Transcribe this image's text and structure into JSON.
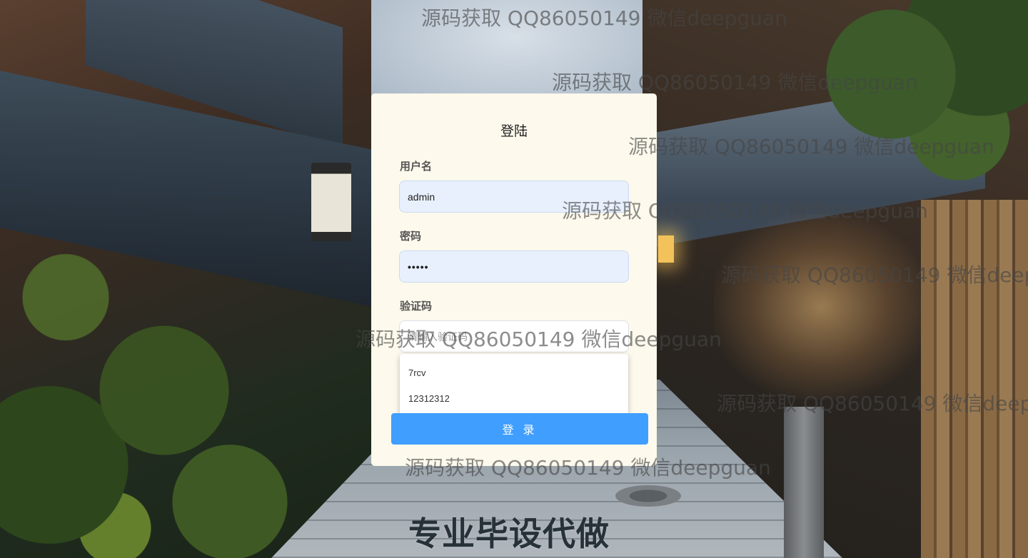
{
  "login": {
    "title": "登陆",
    "username_label": "用户名",
    "username_value": "admin",
    "password_label": "密码",
    "password_value": "•••••",
    "captcha_label": "验证码",
    "captcha_placeholder": "请输入验证码",
    "submit_label": "登 录"
  },
  "autocomplete": {
    "options": [
      "7rcv",
      "12312312"
    ]
  },
  "overlay": {
    "watermark": "源码获取 QQ86050149 微信deepguan",
    "promo": "专业毕设代做"
  },
  "colors": {
    "card_bg": "#fdf9ec",
    "primary": "#409eff",
    "autofill_bg": "#e8f0fe"
  }
}
